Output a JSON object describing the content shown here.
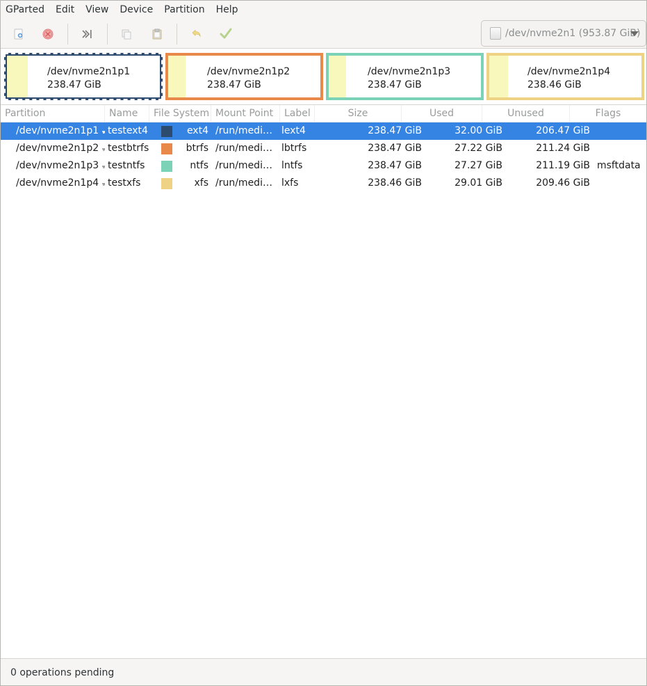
{
  "menubar": {
    "items": [
      "GParted",
      "Edit",
      "View",
      "Device",
      "Partition",
      "Help"
    ]
  },
  "toolbar": {
    "device_selector": "/dev/nvme2n1 (953.87 GiB)"
  },
  "visual": {
    "partitions": [
      {
        "name": "/dev/nvme2n1p1",
        "size": "238.47 GiB",
        "color": "#2d4b6e"
      },
      {
        "name": "/dev/nvme2n1p2",
        "size": "238.47 GiB",
        "color": "#e8894a"
      },
      {
        "name": "/dev/nvme2n1p3",
        "size": "238.47 GiB",
        "color": "#7bd2b7"
      },
      {
        "name": "/dev/nvme2n1p4",
        "size": "238.46 GiB",
        "color": "#efd384"
      }
    ]
  },
  "table": {
    "headers": {
      "partition": "Partition",
      "name": "Name",
      "filesystem": "File System",
      "mountpoint": "Mount Point",
      "label": "Label",
      "size": "Size",
      "used": "Used",
      "unused": "Unused",
      "flags": "Flags"
    },
    "rows": [
      {
        "partition": "/dev/nvme2n1p1",
        "name": "testext4",
        "fs": "ext4",
        "fs_color": "#2d4b6e",
        "mount": "/run/media…",
        "label": "lext4",
        "size": "238.47 GiB",
        "used": "32.00 GiB",
        "unused": "206.47 GiB",
        "flags": ""
      },
      {
        "partition": "/dev/nvme2n1p2",
        "name": "testbtrfs",
        "fs": "btrfs",
        "fs_color": "#e8894a",
        "mount": "/run/media…",
        "label": "lbtrfs",
        "size": "238.47 GiB",
        "used": "27.22 GiB",
        "unused": "211.24 GiB",
        "flags": ""
      },
      {
        "partition": "/dev/nvme2n1p3",
        "name": "testntfs",
        "fs": "ntfs",
        "fs_color": "#7bd2b7",
        "mount": "/run/media…",
        "label": "lntfs",
        "size": "238.47 GiB",
        "used": "27.27 GiB",
        "unused": "211.19 GiB",
        "flags": "msftdata"
      },
      {
        "partition": "/dev/nvme2n1p4",
        "name": "testxfs",
        "fs": "xfs",
        "fs_color": "#efd384",
        "mount": "/run/media…",
        "label": "lxfs",
        "size": "238.46 GiB",
        "used": "29.01 GiB",
        "unused": "209.46 GiB",
        "flags": ""
      }
    ]
  },
  "statusbar": {
    "text": "0 operations pending"
  }
}
